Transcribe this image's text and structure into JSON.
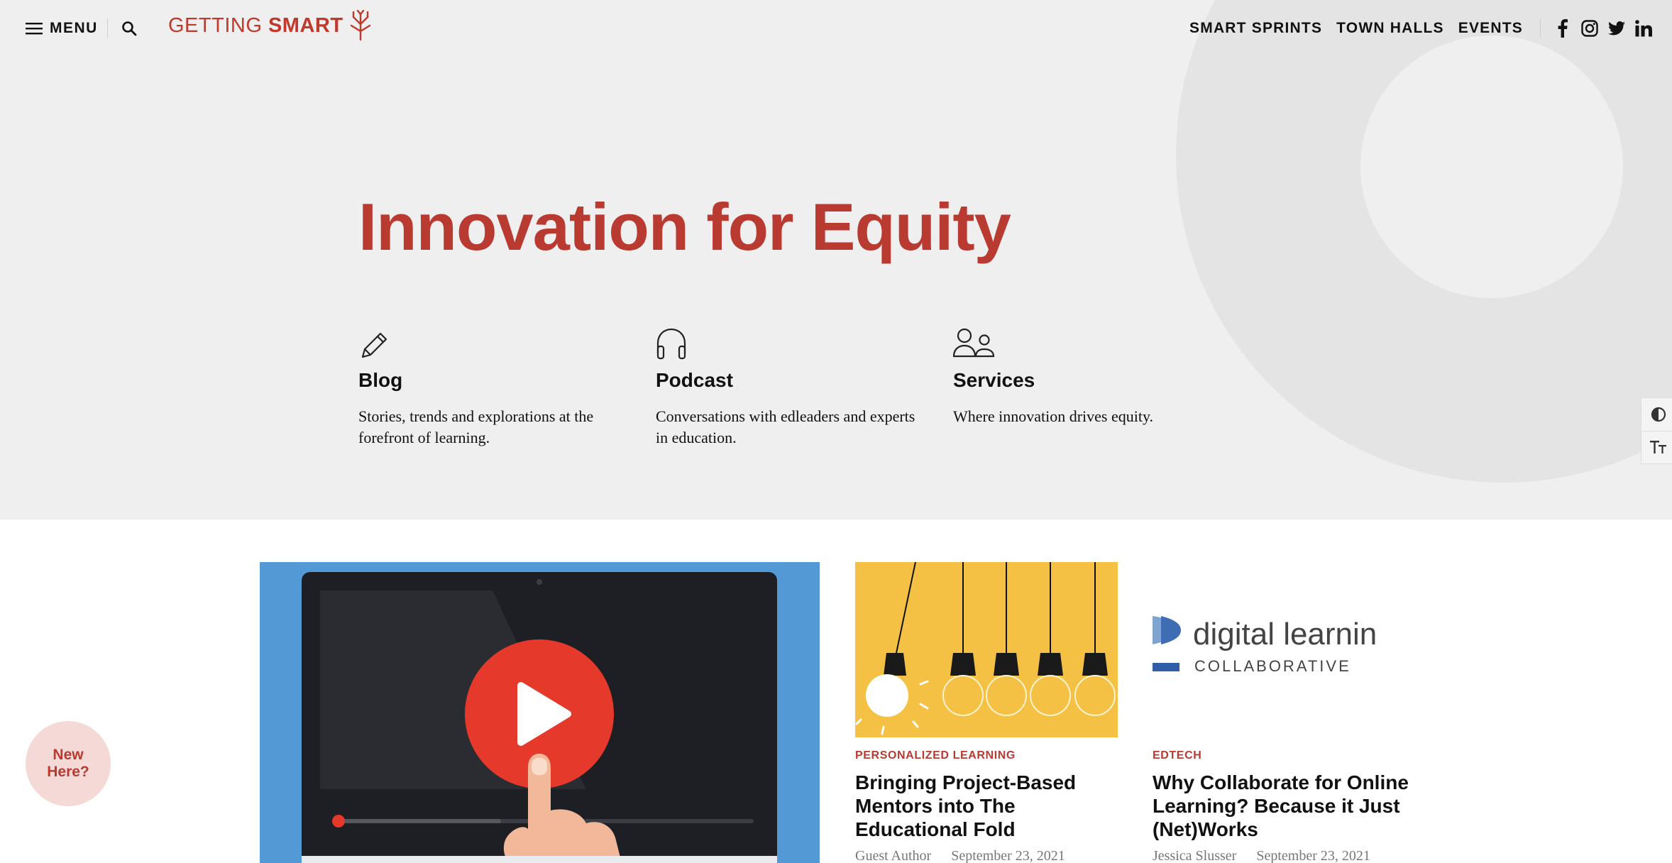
{
  "header": {
    "menu_label": "MENU",
    "logo": {
      "part1": "GETTING",
      "part2": "SMART"
    },
    "nav": [
      "SMART SPRINTS",
      "TOWN HALLS",
      "EVENTS"
    ],
    "social": [
      "facebook-icon",
      "instagram-icon",
      "twitter-icon",
      "linkedin-icon"
    ]
  },
  "hero": {
    "title": "Innovation for Equity",
    "features": [
      {
        "icon": "pencil-icon",
        "title": "Blog",
        "text": "Stories, trends and explorations at the forefront of learning."
      },
      {
        "icon": "headphones-icon",
        "title": "Podcast",
        "text": "Conversations with edleaders and experts in education."
      },
      {
        "icon": "people-icon",
        "title": "Services",
        "text": "Where innovation drives equity."
      }
    ]
  },
  "side_tools": [
    "contrast-icon",
    "text-size-icon"
  ],
  "articles": [
    {
      "category": "PERSONALIZED LEARNING",
      "title": "Bringing Project-Based Mentors into The Educational Fold",
      "author": "Guest Author",
      "date": "September 23, 2021"
    },
    {
      "category": "EDTECH",
      "title": "Why Collaborate for Online Learning? Because it Just (Net)Works",
      "author": "Jessica Slusser",
      "date": "September 23, 2021",
      "thumb_text": {
        "line1": "digital learnin",
        "line2": "COLLABORATIVE"
      }
    }
  ],
  "new_here": "New\nHere?",
  "colors": {
    "brand_red": "#b83a30",
    "hero_bg": "#efefef",
    "video_blue": "#5399d6",
    "bulb_yellow": "#f4c144"
  }
}
